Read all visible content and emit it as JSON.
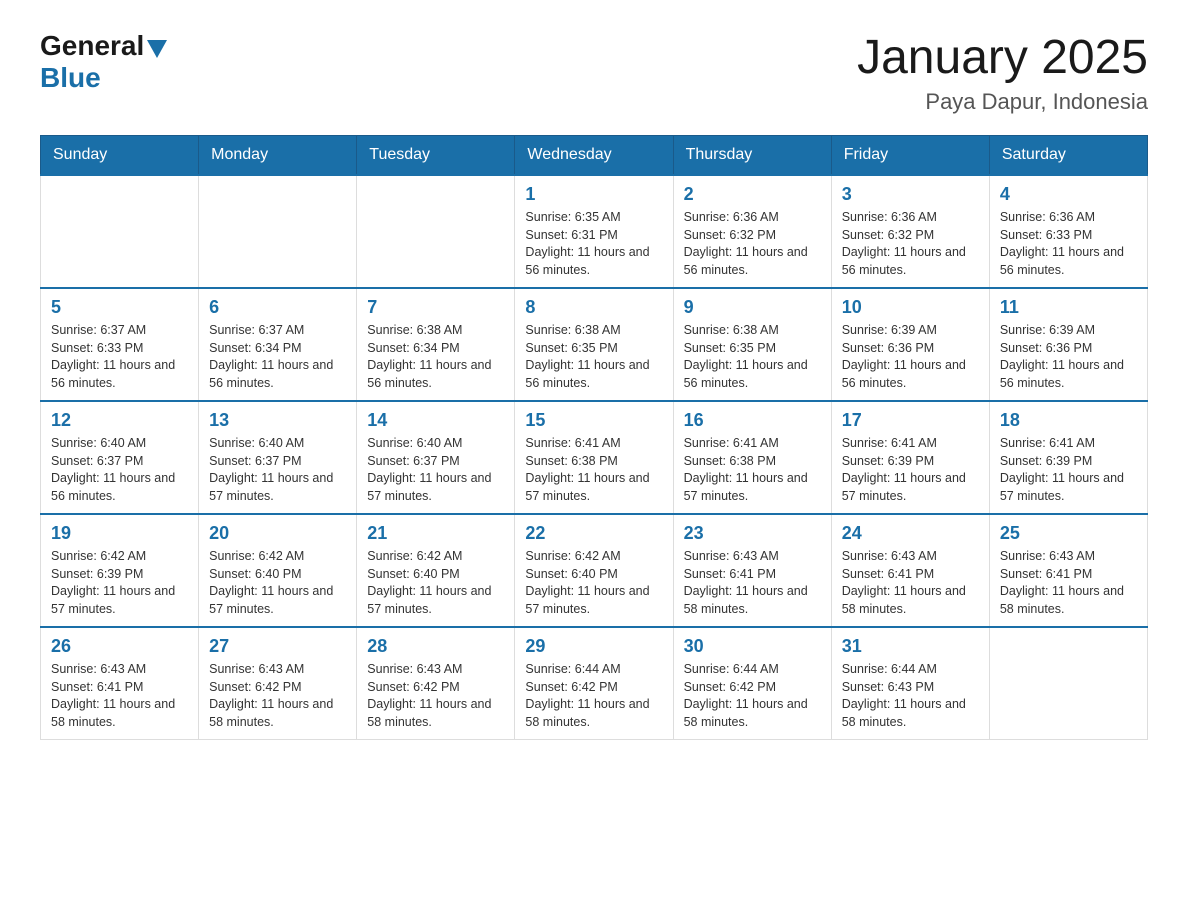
{
  "header": {
    "logo_general": "General",
    "logo_blue": "Blue",
    "month_title": "January 2025",
    "location": "Paya Dapur, Indonesia"
  },
  "weekdays": [
    "Sunday",
    "Monday",
    "Tuesday",
    "Wednesday",
    "Thursday",
    "Friday",
    "Saturday"
  ],
  "weeks": [
    [
      {
        "day": "",
        "info": ""
      },
      {
        "day": "",
        "info": ""
      },
      {
        "day": "",
        "info": ""
      },
      {
        "day": "1",
        "info": "Sunrise: 6:35 AM\nSunset: 6:31 PM\nDaylight: 11 hours and 56 minutes."
      },
      {
        "day": "2",
        "info": "Sunrise: 6:36 AM\nSunset: 6:32 PM\nDaylight: 11 hours and 56 minutes."
      },
      {
        "day": "3",
        "info": "Sunrise: 6:36 AM\nSunset: 6:32 PM\nDaylight: 11 hours and 56 minutes."
      },
      {
        "day": "4",
        "info": "Sunrise: 6:36 AM\nSunset: 6:33 PM\nDaylight: 11 hours and 56 minutes."
      }
    ],
    [
      {
        "day": "5",
        "info": "Sunrise: 6:37 AM\nSunset: 6:33 PM\nDaylight: 11 hours and 56 minutes."
      },
      {
        "day": "6",
        "info": "Sunrise: 6:37 AM\nSunset: 6:34 PM\nDaylight: 11 hours and 56 minutes."
      },
      {
        "day": "7",
        "info": "Sunrise: 6:38 AM\nSunset: 6:34 PM\nDaylight: 11 hours and 56 minutes."
      },
      {
        "day": "8",
        "info": "Sunrise: 6:38 AM\nSunset: 6:35 PM\nDaylight: 11 hours and 56 minutes."
      },
      {
        "day": "9",
        "info": "Sunrise: 6:38 AM\nSunset: 6:35 PM\nDaylight: 11 hours and 56 minutes."
      },
      {
        "day": "10",
        "info": "Sunrise: 6:39 AM\nSunset: 6:36 PM\nDaylight: 11 hours and 56 minutes."
      },
      {
        "day": "11",
        "info": "Sunrise: 6:39 AM\nSunset: 6:36 PM\nDaylight: 11 hours and 56 minutes."
      }
    ],
    [
      {
        "day": "12",
        "info": "Sunrise: 6:40 AM\nSunset: 6:37 PM\nDaylight: 11 hours and 56 minutes."
      },
      {
        "day": "13",
        "info": "Sunrise: 6:40 AM\nSunset: 6:37 PM\nDaylight: 11 hours and 57 minutes."
      },
      {
        "day": "14",
        "info": "Sunrise: 6:40 AM\nSunset: 6:37 PM\nDaylight: 11 hours and 57 minutes."
      },
      {
        "day": "15",
        "info": "Sunrise: 6:41 AM\nSunset: 6:38 PM\nDaylight: 11 hours and 57 minutes."
      },
      {
        "day": "16",
        "info": "Sunrise: 6:41 AM\nSunset: 6:38 PM\nDaylight: 11 hours and 57 minutes."
      },
      {
        "day": "17",
        "info": "Sunrise: 6:41 AM\nSunset: 6:39 PM\nDaylight: 11 hours and 57 minutes."
      },
      {
        "day": "18",
        "info": "Sunrise: 6:41 AM\nSunset: 6:39 PM\nDaylight: 11 hours and 57 minutes."
      }
    ],
    [
      {
        "day": "19",
        "info": "Sunrise: 6:42 AM\nSunset: 6:39 PM\nDaylight: 11 hours and 57 minutes."
      },
      {
        "day": "20",
        "info": "Sunrise: 6:42 AM\nSunset: 6:40 PM\nDaylight: 11 hours and 57 minutes."
      },
      {
        "day": "21",
        "info": "Sunrise: 6:42 AM\nSunset: 6:40 PM\nDaylight: 11 hours and 57 minutes."
      },
      {
        "day": "22",
        "info": "Sunrise: 6:42 AM\nSunset: 6:40 PM\nDaylight: 11 hours and 57 minutes."
      },
      {
        "day": "23",
        "info": "Sunrise: 6:43 AM\nSunset: 6:41 PM\nDaylight: 11 hours and 58 minutes."
      },
      {
        "day": "24",
        "info": "Sunrise: 6:43 AM\nSunset: 6:41 PM\nDaylight: 11 hours and 58 minutes."
      },
      {
        "day": "25",
        "info": "Sunrise: 6:43 AM\nSunset: 6:41 PM\nDaylight: 11 hours and 58 minutes."
      }
    ],
    [
      {
        "day": "26",
        "info": "Sunrise: 6:43 AM\nSunset: 6:41 PM\nDaylight: 11 hours and 58 minutes."
      },
      {
        "day": "27",
        "info": "Sunrise: 6:43 AM\nSunset: 6:42 PM\nDaylight: 11 hours and 58 minutes."
      },
      {
        "day": "28",
        "info": "Sunrise: 6:43 AM\nSunset: 6:42 PM\nDaylight: 11 hours and 58 minutes."
      },
      {
        "day": "29",
        "info": "Sunrise: 6:44 AM\nSunset: 6:42 PM\nDaylight: 11 hours and 58 minutes."
      },
      {
        "day": "30",
        "info": "Sunrise: 6:44 AM\nSunset: 6:42 PM\nDaylight: 11 hours and 58 minutes."
      },
      {
        "day": "31",
        "info": "Sunrise: 6:44 AM\nSunset: 6:43 PM\nDaylight: 11 hours and 58 minutes."
      },
      {
        "day": "",
        "info": ""
      }
    ]
  ]
}
